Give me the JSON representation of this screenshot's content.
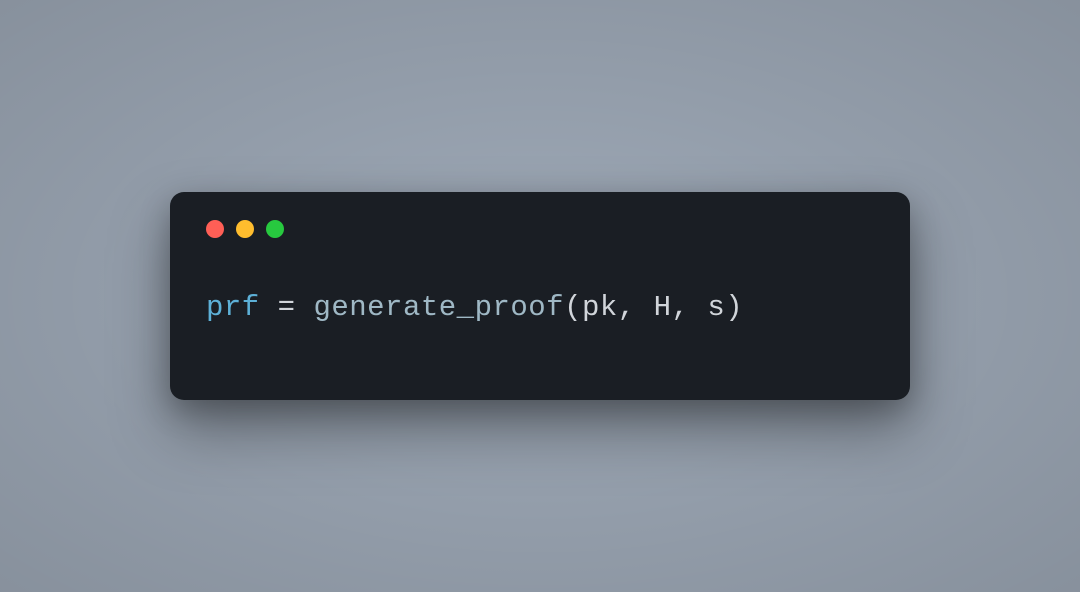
{
  "window": {
    "controls": {
      "close_color": "#ff5f56",
      "minimize_color": "#ffbd2e",
      "zoom_color": "#27c93f"
    }
  },
  "code": {
    "var": "prf",
    "assign": " = ",
    "func": "generate_proof",
    "open": "(",
    "arg1": "pk",
    "sep1": ", ",
    "arg2": "H",
    "sep2": ", ",
    "arg3": "s",
    "close": ")"
  }
}
